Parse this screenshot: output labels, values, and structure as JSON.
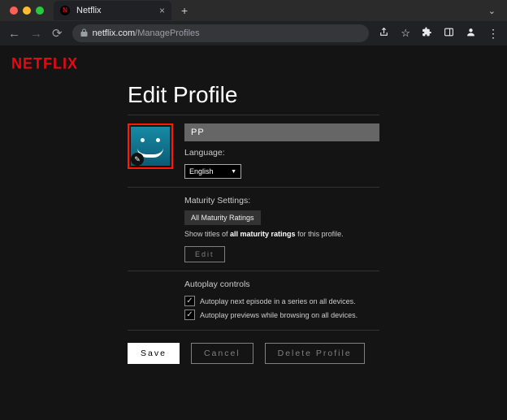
{
  "browser": {
    "tab": {
      "title": "Netflix"
    },
    "url": {
      "host": "netflix.com",
      "path": "/ManageProfiles"
    }
  },
  "header": {
    "logo": "NETFLIX"
  },
  "profile": {
    "title": "Edit Profile",
    "name_value": "PP",
    "language_label": "Language:",
    "language_value": "English"
  },
  "maturity": {
    "title": "Maturity Settings:",
    "rating_chip": "All Maturity Ratings",
    "desc_prefix": "Show titles of ",
    "desc_bold": "all maturity ratings",
    "desc_suffix": " for this profile.",
    "edit_label": "Edit"
  },
  "autoplay": {
    "title": "Autoplay controls",
    "opt1": "Autoplay next episode in a series on all devices.",
    "opt2": "Autoplay previews while browsing on all devices."
  },
  "buttons": {
    "save": "Save",
    "cancel": "Cancel",
    "delete": "Delete Profile"
  }
}
